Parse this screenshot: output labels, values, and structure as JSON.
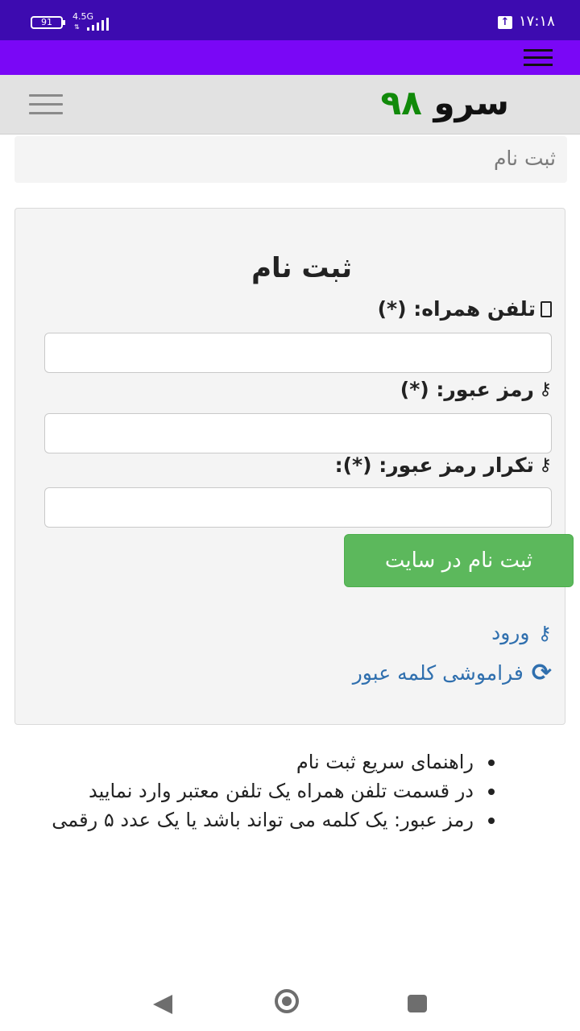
{
  "status_bar": {
    "battery": "91",
    "network": "4.5G",
    "clock": "۱۷:۱۸",
    "icons": [
      "battery-icon",
      "signal-icon",
      "upload-icon"
    ]
  },
  "header": {
    "brand_name": "سرو",
    "brand_number": "۹۸",
    "brand_number_color": "#118a0a"
  },
  "breadcrumb": {
    "current": "ثبت نام"
  },
  "form": {
    "title": "ثبت نام",
    "phone_label": "تلفن همراه: (*)",
    "password_label": "رمز عبور: (*)",
    "password_repeat_label": "تکرار رمز عبور: (*):",
    "phone_value": "",
    "password_value": "",
    "password_repeat_value": "",
    "submit_label": "ثبت نام در سایت",
    "submit_color": "#5cb85c"
  },
  "links": {
    "login": "ورود",
    "forgot_password": "فراموشی کلمه عبور",
    "link_color": "#2f6fae"
  },
  "guide": {
    "items": [
      "راهنمای سریع ثبت نام",
      "در قسمت تلفن همراه یک تلفن معتبر وارد نمایید",
      "رمز عبور: یک کلمه می تواند باشد یا یک عدد ۵ رقمی"
    ]
  },
  "colors": {
    "status_bar": "#3d0bb0",
    "app_bar": "#7a07f6",
    "header_bg": "#e2e2e2"
  }
}
